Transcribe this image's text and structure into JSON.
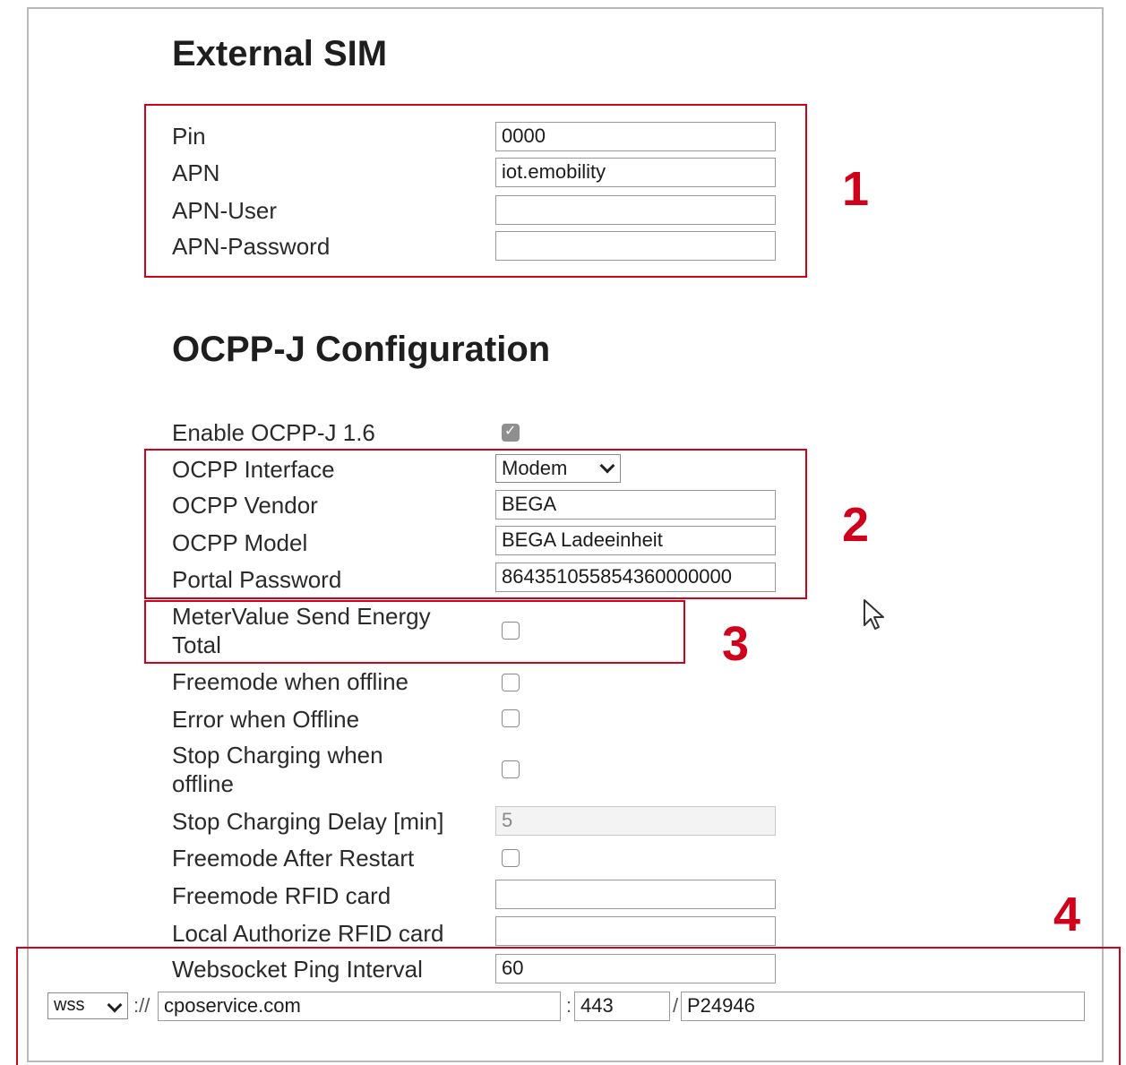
{
  "external_sim": {
    "title": "External SIM",
    "pin_label": "Pin",
    "pin_value": "0000",
    "apn_label": "APN",
    "apn_value": "iot.emobility",
    "apn_user_label": "APN-User",
    "apn_user_value": "",
    "apn_password_label": "APN-Password",
    "apn_password_value": ""
  },
  "ocpp": {
    "title": "OCPP-J Configuration",
    "enable_label": "Enable OCPP-J 1.6",
    "enable_checked": true,
    "interface_label": "OCPP Interface",
    "interface_value": "Modem",
    "vendor_label": "OCPP Vendor",
    "vendor_value": "BEGA",
    "model_label": "OCPP Model",
    "model_value": "BEGA Ladeeinheit",
    "portal_password_label": "Portal Password",
    "portal_password_value": "864351055854360000000",
    "metervalue_label_line1": "MeterValue Send Energy",
    "metervalue_label_line2": "Total",
    "metervalue_checked": false,
    "freemode_offline_label": "Freemode when offline",
    "freemode_offline_checked": false,
    "error_offline_label": "Error when Offline",
    "error_offline_checked": false,
    "stop_charging_label_line1": "Stop Charging when",
    "stop_charging_label_line2": "offline",
    "stop_charging_checked": false,
    "stop_delay_label": "Stop Charging Delay [min]",
    "stop_delay_value": "5",
    "freemode_restart_label": "Freemode After Restart",
    "freemode_restart_checked": false,
    "freemode_rfid_label": "Freemode RFID card",
    "freemode_rfid_value": "",
    "local_auth_rfid_label": "Local Authorize RFID card",
    "local_auth_rfid_value": "",
    "ping_interval_label": "Websocket Ping Interval",
    "ping_interval_value": "60"
  },
  "websocket": {
    "scheme_value": "wss",
    "separator": "://",
    "host_value": "cposervice.com",
    "colon": ":",
    "port_value": "443",
    "slash": "/",
    "path_value": "P24946"
  },
  "annotations": {
    "n1": "1",
    "n2": "2",
    "n3": "3",
    "n4": "4",
    "color": "#d0021b"
  }
}
